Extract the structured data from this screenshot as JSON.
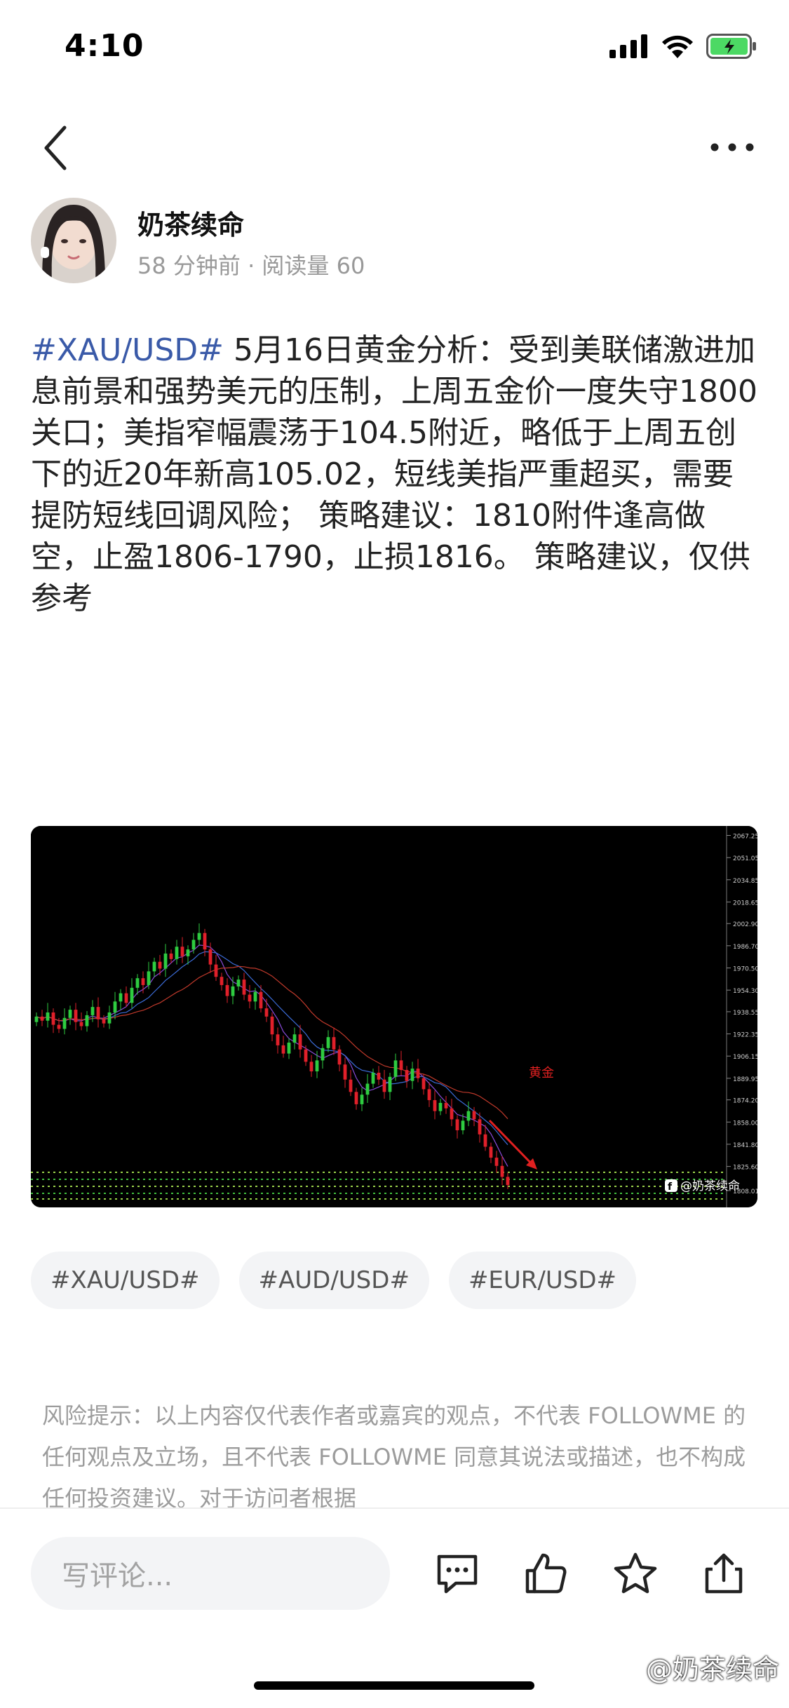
{
  "status_bar": {
    "time": "4:10",
    "battery_color": "#4cd964"
  },
  "author": {
    "name": "奶茶续命",
    "meta": "58 分钟前 · 阅读量 60"
  },
  "post": {
    "tag": "#XAU/USD#",
    "body": " 5月16日黄金分析：受到美联储激进加息前景和强势美元的压制，上周五金价一度失守1800关口；美指窄幅震荡于104.5附近，略低于上周五创下的近20年新高105.02，短线美指严重超买，需要提防短线回调风险； 策略建议：1810附件逢高做空，止盈1806-1790，止损1816。 策略建议，仅供参考"
  },
  "chart_data": {
    "type": "candlestick",
    "label": "黄金",
    "watermark": "@奶茶续命",
    "y_ticks": [
      "2067.25",
      "2051.05",
      "2034.85",
      "2018.65",
      "2002.90",
      "1986.70",
      "1970.50",
      "1954.30",
      "1938.55",
      "1922.35",
      "1906.15",
      "1889.95",
      "1874.20",
      "1858.00",
      "1841.80",
      "1825.60",
      "1808.01"
    ],
    "ylim": [
      1808,
      2068
    ],
    "close": [
      1935,
      1932,
      1938,
      1929,
      1926,
      1934,
      1940,
      1931,
      1928,
      1936,
      1942,
      1933,
      1930,
      1938,
      1946,
      1952,
      1945,
      1956,
      1963,
      1958,
      1968,
      1975,
      1970,
      1981,
      1977,
      1986,
      1979,
      1984,
      1991,
      1996,
      1984,
      1973,
      1964,
      1958,
      1950,
      1957,
      1962,
      1951,
      1946,
      1953,
      1941,
      1935,
      1922,
      1914,
      1908,
      1916,
      1922,
      1911,
      1902,
      1895,
      1903,
      1912,
      1920,
      1911,
      1900,
      1889,
      1880,
      1871,
      1878,
      1886,
      1894,
      1889,
      1880,
      1891,
      1903,
      1896,
      1888,
      1897,
      1890,
      1882,
      1874,
      1866,
      1872,
      1868,
      1860,
      1852,
      1859,
      1866,
      1860,
      1849,
      1840,
      1832,
      1826,
      1818,
      1812
    ]
  },
  "tags": [
    "#XAU/USD#",
    "#AUD/USD#",
    "#EUR/USD#"
  ],
  "risk_notice": "风险提示：以上内容仅代表作者或嘉宾的观点，不代表 FOLLOWME 的任何观点及立场，且不代表 FOLLOWME 同意其说法或描述，也不构成任何投资建议。对于访问者根据",
  "comment_placeholder": "写评论...",
  "watermark": "@奶茶续命",
  "icons": [
    "back-icon",
    "more-icon",
    "signal-icon",
    "wifi-icon",
    "battery-icon",
    "comment-icon",
    "like-icon",
    "star-icon",
    "share-icon"
  ]
}
